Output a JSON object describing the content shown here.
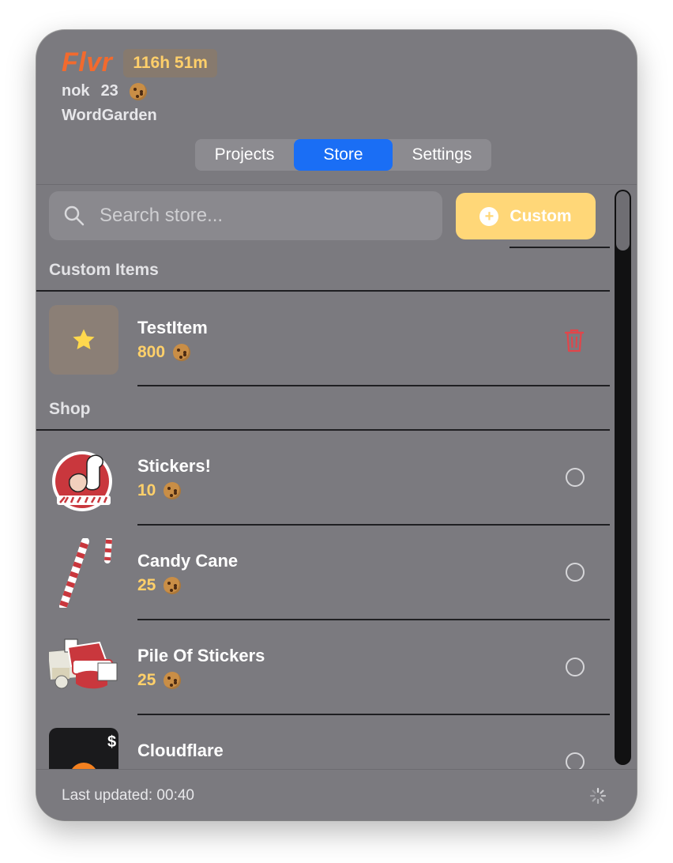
{
  "header": {
    "brand": "Flvr",
    "time_badge": "116h 51m",
    "username": "nok",
    "cookie_count": "23",
    "project": "WordGarden"
  },
  "tabs": [
    {
      "label": "Projects",
      "active": false
    },
    {
      "label": "Store",
      "active": true
    },
    {
      "label": "Settings",
      "active": false
    }
  ],
  "search": {
    "placeholder": "Search store...",
    "value": ""
  },
  "custom_button": {
    "label": "Custom"
  },
  "sections": {
    "custom_items": "Custom Items",
    "shop": "Shop"
  },
  "custom_items": [
    {
      "name": "TestItem",
      "price": "800",
      "icon": "star-icon",
      "action": "trash-icon"
    }
  ],
  "shop_items": [
    {
      "name": "Stickers!",
      "price": "10"
    },
    {
      "name": "Candy Cane",
      "price": "25"
    },
    {
      "name": "Pile Of Stickers",
      "price": "25"
    },
    {
      "name": "Cloudflare",
      "price": ""
    }
  ],
  "footer": {
    "last_updated": "Last updated: 00:40"
  },
  "colors": {
    "accent": "#1a6ef5",
    "brand": "#f26a2e",
    "price": "#ffd06a",
    "custom_button": "#ffd778",
    "delete": "#e2454a"
  }
}
